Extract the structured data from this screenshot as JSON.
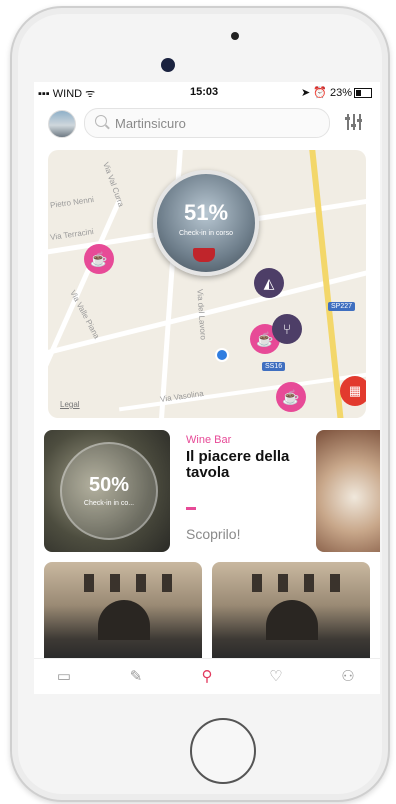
{
  "status_bar": {
    "carrier": "WIND",
    "time": "15:03",
    "battery": "23%"
  },
  "search": {
    "placeholder": "Martinsicuro"
  },
  "map": {
    "street_labels": [
      "Via Val Curra",
      "Pietro Nenni",
      "Via Terracini",
      "Via Valle Piana",
      "Via del Lavoro",
      "Via Vasolina"
    ],
    "road_shields": [
      "SP227",
      "SS16"
    ],
    "attribution": "Legal",
    "bubble": {
      "percent": "51%",
      "label": "Check-in in corso"
    },
    "pins": [
      {
        "icon": "coffee-icon"
      },
      {
        "icon": "pizza-icon"
      },
      {
        "icon": "coffee-icon"
      },
      {
        "icon": "restaurant-icon"
      },
      {
        "icon": "coffee-icon"
      }
    ]
  },
  "featured": {
    "checkin_percent": "50%",
    "checkin_label": "Check-in in co...",
    "category": "Wine Bar",
    "title": "Il piacere della tavola",
    "cta": "Scoprilo!"
  },
  "tab_bar": [
    {
      "name": "clipboard-icon",
      "glyph": "▭"
    },
    {
      "name": "pencil-icon",
      "glyph": "✎"
    },
    {
      "name": "map-pin-icon",
      "glyph": "⚲"
    },
    {
      "name": "heart-icon",
      "glyph": "♡"
    },
    {
      "name": "people-icon",
      "glyph": "⚇"
    }
  ],
  "colors": {
    "accent": "#e74a97",
    "active_tab": "#e23a5e",
    "fab": "#e23a2e"
  }
}
